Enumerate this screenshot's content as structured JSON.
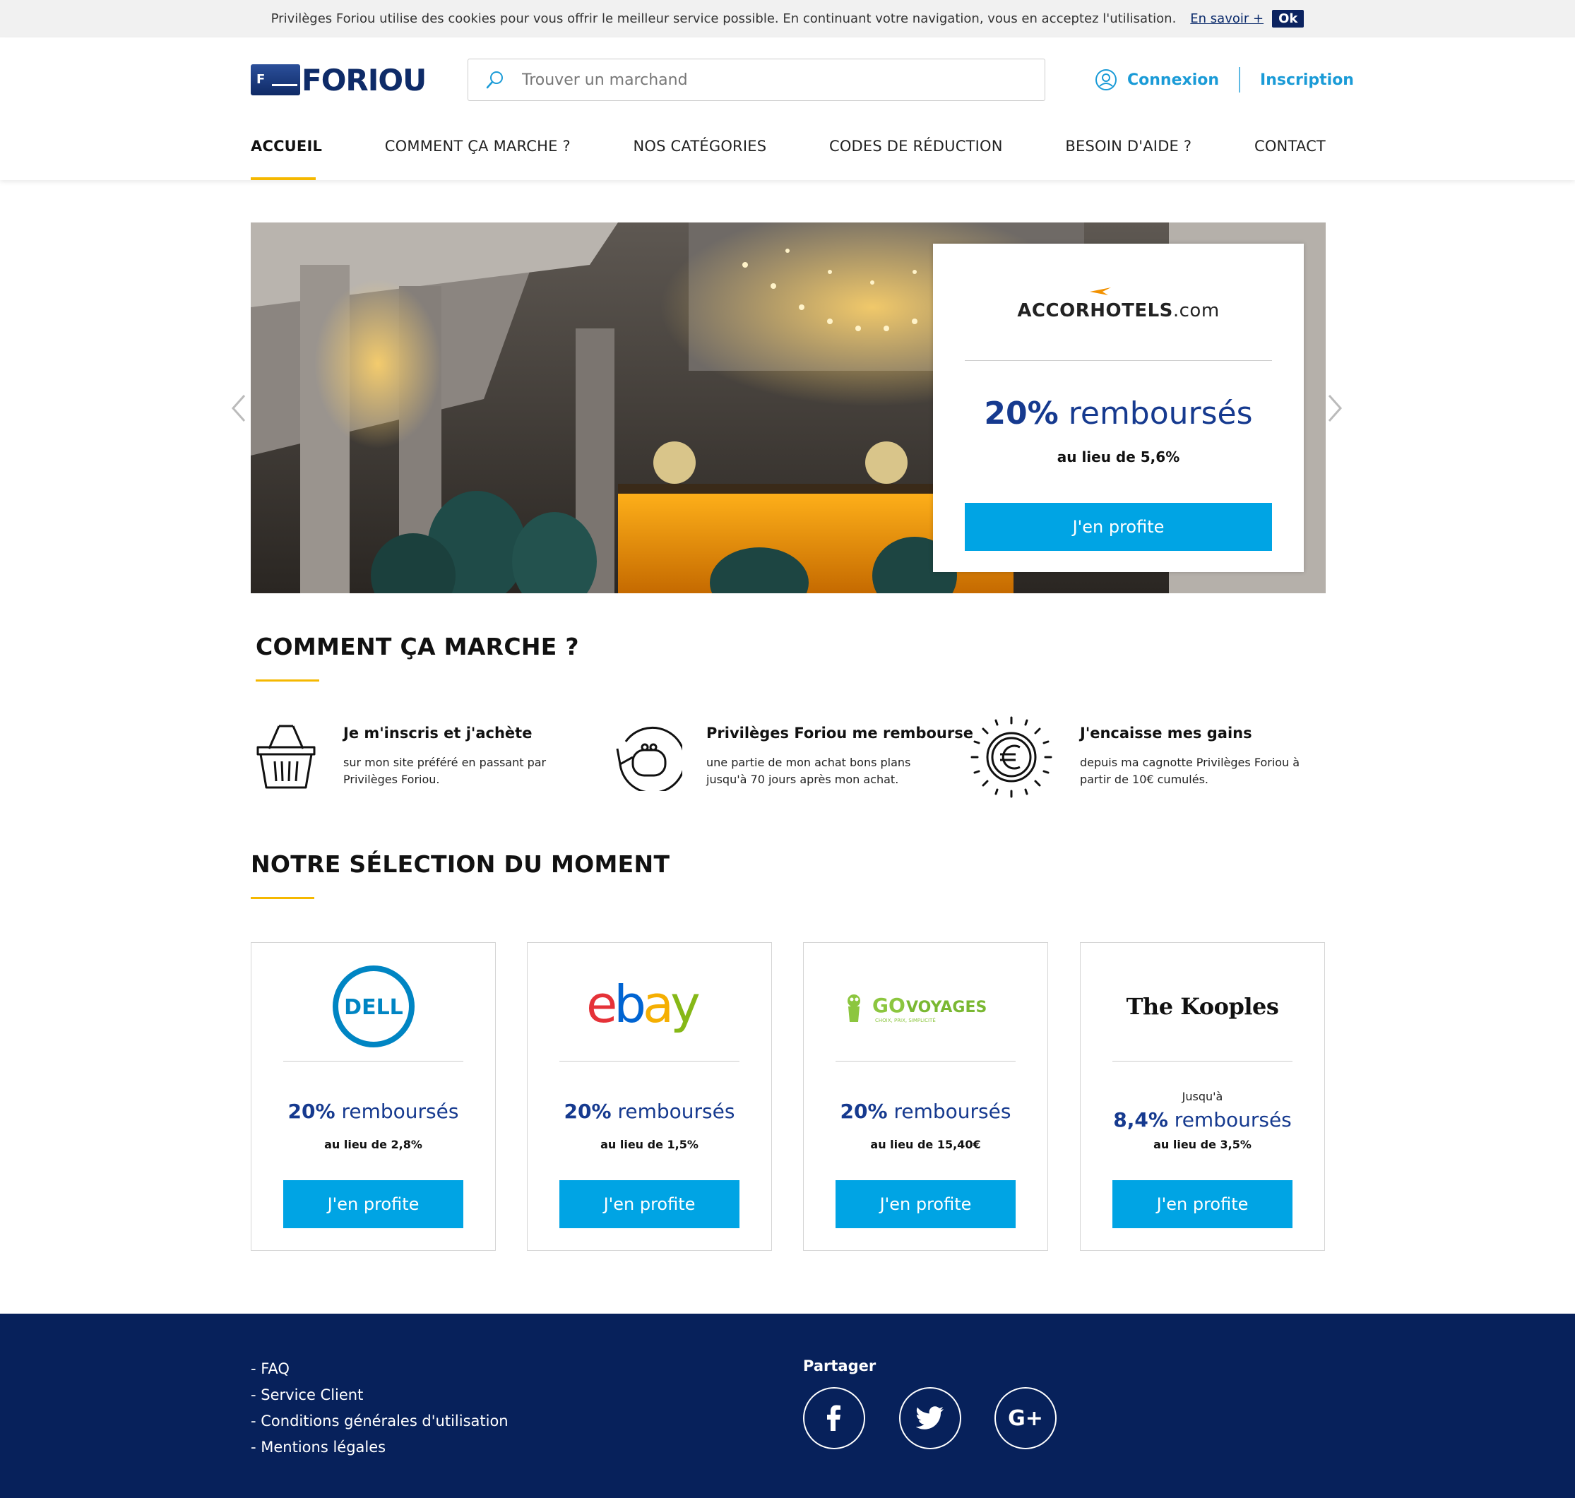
{
  "cookie": {
    "text": "Privilèges Foriou utilise des cookies pour vous offrir le meilleur service possible. En continuant votre navigation, vous en acceptez l'utilisation.",
    "more": "En savoir +",
    "ok": "Ok"
  },
  "header": {
    "logo_text": "FORIOU",
    "logo_mark": "F",
    "search_placeholder": "Trouver un marchand",
    "login": "Connexion",
    "signup": "Inscription"
  },
  "nav": {
    "items": [
      "ACCUEIL",
      "COMMENT ÇA MARCHE ?",
      "NOS CATÉGORIES",
      "CODES DE RÉDUCTION",
      "BESOIN D'AIDE ?",
      "CONTACT"
    ]
  },
  "hero": {
    "brand_main": "ACCORHOTELS",
    "brand_suffix": ".com",
    "rate_value": "20%",
    "rate_label": "remboursés",
    "instead": "au lieu de 5,6%",
    "button": "J'en profite"
  },
  "how": {
    "title": "COMMENT ÇA MARCHE ?",
    "steps": [
      {
        "title": "Je m'inscris et j'achète",
        "desc": "sur mon site préféré en passant par Privilèges Foriou."
      },
      {
        "title": "Privilèges Foriou me rembourse",
        "desc": "une partie de mon achat bons plans jusqu'à 70 jours après mon achat."
      },
      {
        "title": "J'encaisse mes gains",
        "desc": "depuis ma cagnotte Privilèges Foriou à partir de 10€ cumulés."
      }
    ]
  },
  "selection": {
    "title": "NOTRE SÉLECTION DU MOMENT",
    "offers": [
      {
        "brand": "DELL",
        "upto": "",
        "rate_value": "20%",
        "rate_label": "remboursés",
        "instead": "au lieu de 2,8%",
        "button": "J'en profite"
      },
      {
        "brand": "ebay",
        "upto": "",
        "rate_value": "20%",
        "rate_label": "remboursés",
        "instead": "au lieu de 1,5%",
        "button": "J'en profite"
      },
      {
        "brand": "GOVOYAGES",
        "brand_tagline": "CHOIX, PRIX, SIMPLICITÉ",
        "upto": "",
        "rate_value": "20%",
        "rate_label": "remboursés",
        "instead": "au lieu de 15,40€",
        "button": "J'en profite"
      },
      {
        "brand": "The Kooples",
        "upto": "Jusqu'à",
        "rate_value": "8,4%",
        "rate_label": "remboursés",
        "instead": "au lieu de 3,5%",
        "button": "J'en profite"
      }
    ]
  },
  "footer": {
    "links": [
      "- FAQ",
      "- Service Client",
      "- Conditions générales d'utilisation",
      "- Mentions légales"
    ],
    "share_title": "Partager",
    "social": [
      "facebook-icon",
      "twitter-icon",
      "google-plus-icon"
    ],
    "google_plus_label": "G+"
  },
  "colors": {
    "accent_blue": "#00a4e4",
    "brand_navy": "#07215b",
    "rate_blue": "#163a8f",
    "underline_yellow": "#f5b800",
    "link_blue": "#1a9bd7"
  }
}
